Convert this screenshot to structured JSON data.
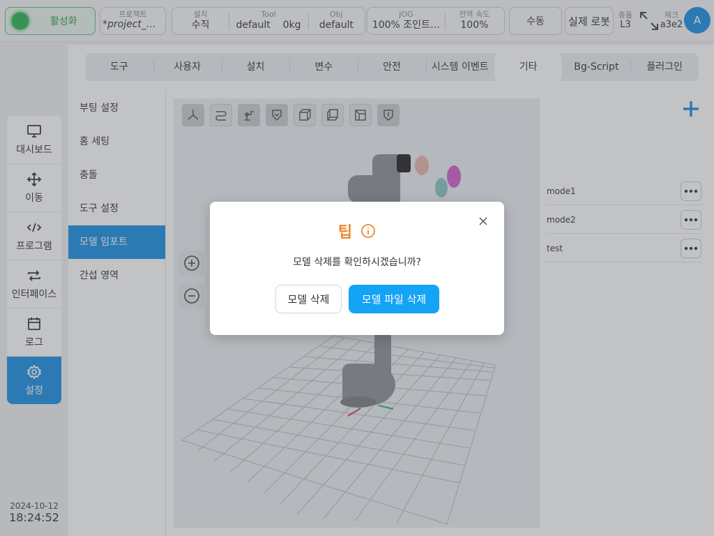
{
  "topbar": {
    "activate_label": "활성화",
    "project_caption": "프로젝트",
    "project_value": "*project_mo…",
    "install": {
      "setup_caption": "설치",
      "setup_value": "수직",
      "tool_caption": "Tool",
      "tool_value": "default",
      "payload_value": "0kg",
      "obj_caption": "Obj",
      "obj_value": "default"
    },
    "jog": {
      "jog_caption": "JOG",
      "jog_value": "100%  조인트…",
      "speed_caption": "전역 속도",
      "speed_value": "100%"
    },
    "manual_label": "수동",
    "real_robot_label": "실제 로봇",
    "collision_caption": "충돌",
    "collision_value": "L3",
    "check_caption": "체크",
    "check_value": "a3e2",
    "avatar_letter": "A"
  },
  "leftnav": {
    "items": [
      {
        "label": "대시보드",
        "icon": "monitor-icon"
      },
      {
        "label": "이동",
        "icon": "move-icon"
      },
      {
        "label": "프로그램",
        "icon": "code-icon"
      },
      {
        "label": "인터페이스",
        "icon": "interface-icon"
      },
      {
        "label": "로그",
        "icon": "calendar-icon"
      },
      {
        "label": "설정",
        "icon": "gear-icon"
      }
    ],
    "active_index": 5
  },
  "datetime": {
    "date": "2024-10-12",
    "time": "18:24:52"
  },
  "tabs": [
    "도구",
    "사용자",
    "설치",
    "변수",
    "안전",
    "시스템 이벤트",
    "기타",
    "Bg-Script",
    "플러그인"
  ],
  "active_tab": 6,
  "subnav": [
    "부팅 설정",
    "홈 세팅",
    "충돌",
    "도구 설정",
    "모델 임포트",
    "간섭 영역"
  ],
  "active_subnav": 4,
  "models": [
    "mode1",
    "mode2",
    "test"
  ],
  "dialog": {
    "title": "팁",
    "message": "모델 삭제를 확인하시겠습니까?",
    "secondary_button": "모델 삭제",
    "primary_button": "모델 파일 삭제"
  },
  "colors": {
    "accent": "#1a8fe3",
    "primary_button": "#14a3f5",
    "warning": "#e8892b",
    "active_green": "#2eb355"
  }
}
